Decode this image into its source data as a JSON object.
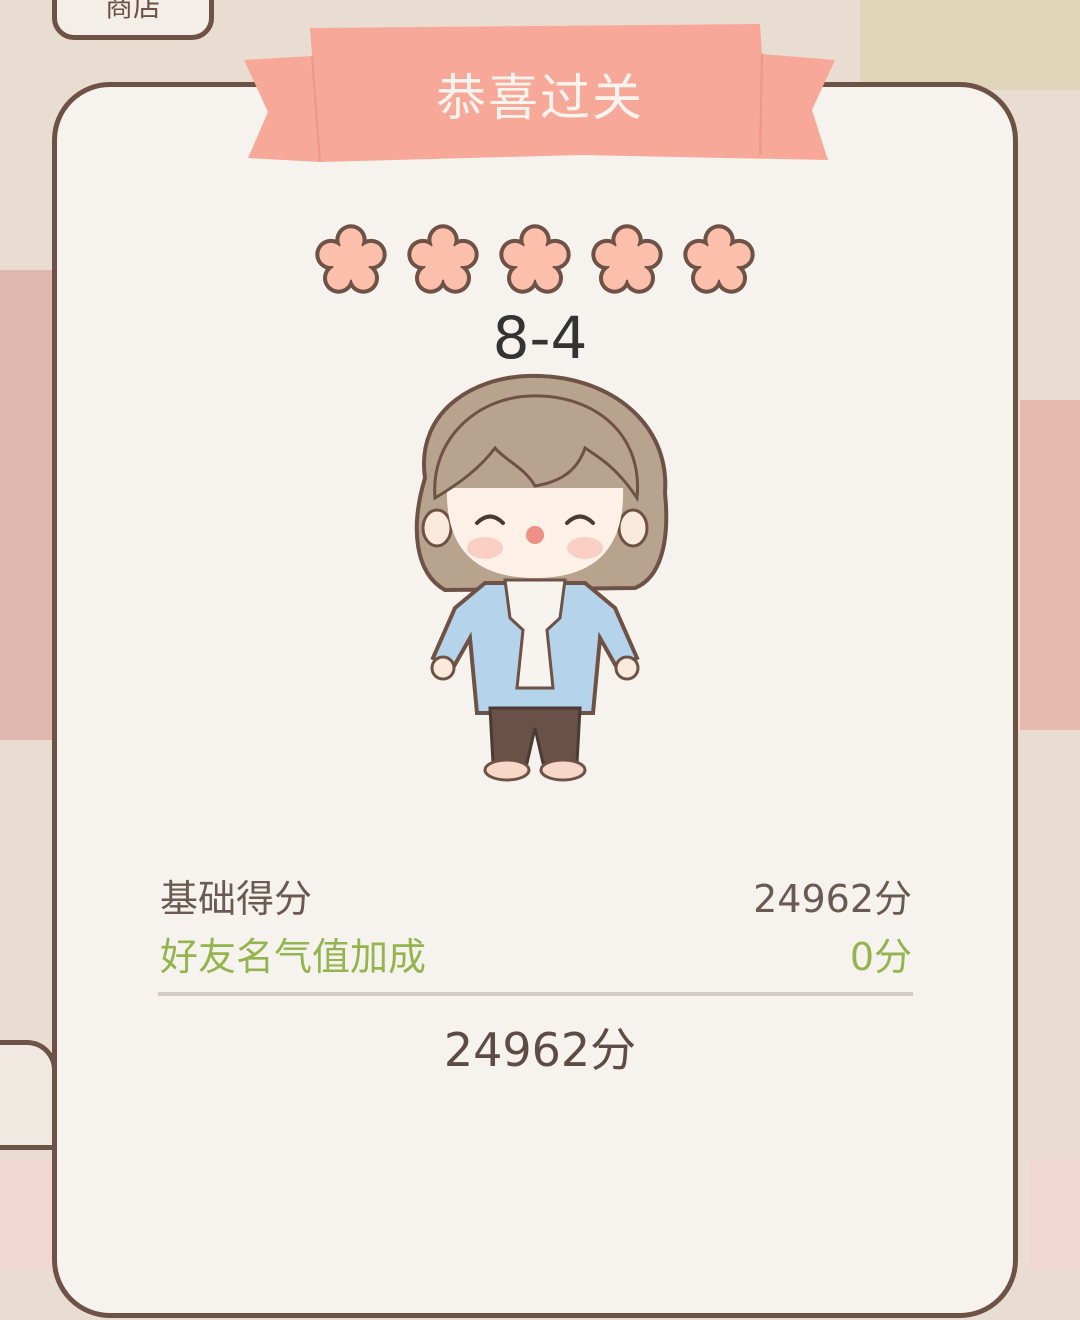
{
  "background": {
    "shop_label": "商店"
  },
  "dialog": {
    "title": "恭喜过关",
    "stars_earned": 5,
    "stars_total": 5,
    "level": "8-4"
  },
  "scores": {
    "base_label": "基础得分",
    "base_value": "24962分",
    "bonus_label": "好友名气值加成",
    "bonus_value": "0分",
    "total": "24962分"
  },
  "colors": {
    "ribbon": "#f7a899",
    "star": "#fbbfab",
    "border": "#6e5246",
    "bonus_text": "#94b44e"
  },
  "icons": {
    "star": "flower-star-icon"
  }
}
